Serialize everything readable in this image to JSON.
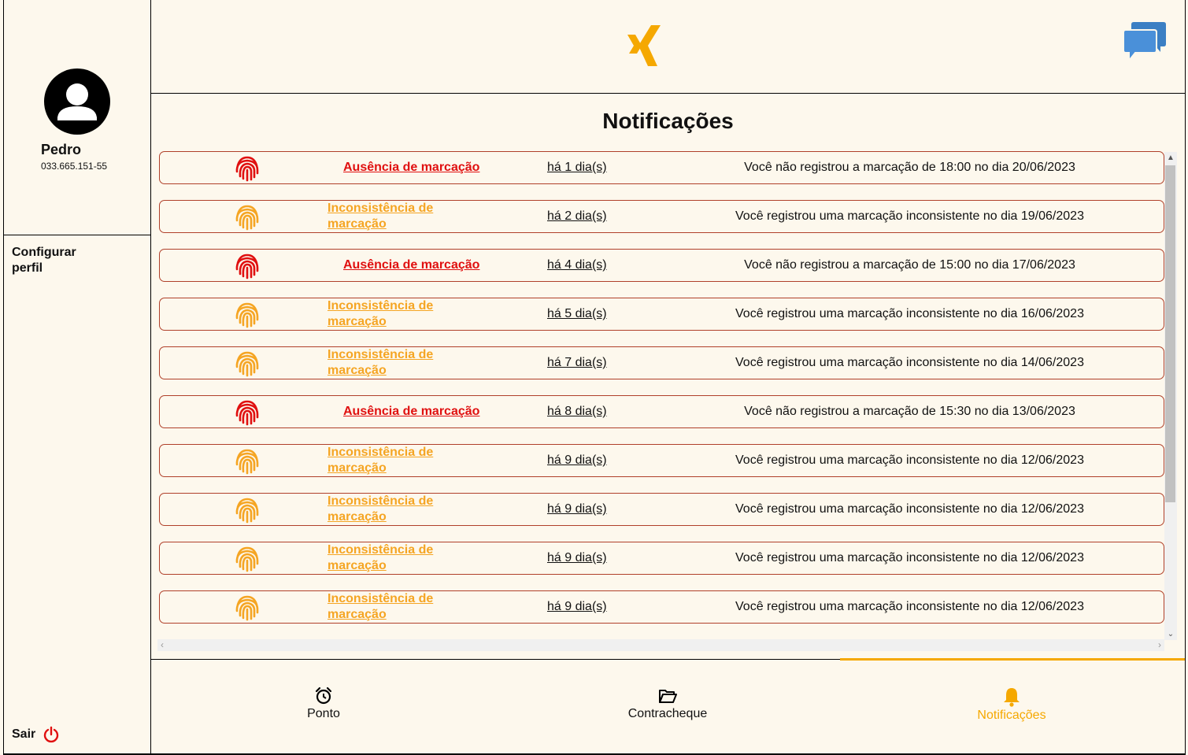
{
  "user": {
    "name": "Pedro",
    "cpf": "033.665.151-55"
  },
  "sidebar": {
    "config_label": "Configurar perfil",
    "logout_label": "Sair"
  },
  "page": {
    "title": "Notificações"
  },
  "colors": {
    "absence": "#e01010",
    "inconsistency": "#f5a523",
    "accent": "#f5a800",
    "chat": "#3b7fc4"
  },
  "notifications": [
    {
      "kind": "absence",
      "type": "Ausência de marcação",
      "ago": "há 1 dia(s)",
      "message": "Você não registrou a marcação de 18:00 no dia 20/06/2023"
    },
    {
      "kind": "inconsistency",
      "type": "Inconsistência de marcação",
      "ago": "há 2 dia(s)",
      "message": "Você registrou uma marcação inconsistente no dia 19/06/2023"
    },
    {
      "kind": "absence",
      "type": "Ausência de marcação",
      "ago": "há 4 dia(s)",
      "message": "Você não registrou a marcação de 15:00 no dia 17/06/2023"
    },
    {
      "kind": "inconsistency",
      "type": "Inconsistência de marcação",
      "ago": "há 5 dia(s)",
      "message": "Você registrou uma marcação inconsistente no dia 16/06/2023"
    },
    {
      "kind": "inconsistency",
      "type": "Inconsistência de marcação",
      "ago": "há 7 dia(s)",
      "message": "Você registrou uma marcação inconsistente no dia 14/06/2023"
    },
    {
      "kind": "absence",
      "type": "Ausência de marcação",
      "ago": "há 8 dia(s)",
      "message": "Você não registrou a marcação de 15:30 no dia 13/06/2023"
    },
    {
      "kind": "inconsistency",
      "type": "Inconsistência de marcação",
      "ago": "há 9 dia(s)",
      "message": "Você registrou uma marcação inconsistente no dia 12/06/2023"
    },
    {
      "kind": "inconsistency",
      "type": "Inconsistência de marcação",
      "ago": "há 9 dia(s)",
      "message": "Você registrou uma marcação inconsistente no dia 12/06/2023"
    },
    {
      "kind": "inconsistency",
      "type": "Inconsistência de marcação",
      "ago": "há 9 dia(s)",
      "message": "Você registrou uma marcação inconsistente no dia 12/06/2023"
    },
    {
      "kind": "inconsistency",
      "type": "Inconsistência de marcação",
      "ago": "há 9 dia(s)",
      "message": "Você registrou uma marcação inconsistente no dia 12/06/2023"
    }
  ],
  "nav": [
    {
      "label": "Ponto",
      "icon": "alarm-clock-icon"
    },
    {
      "label": "Contracheque",
      "icon": "folder-icon"
    },
    {
      "label": "Notificações",
      "icon": "bell-icon",
      "active": true
    }
  ]
}
